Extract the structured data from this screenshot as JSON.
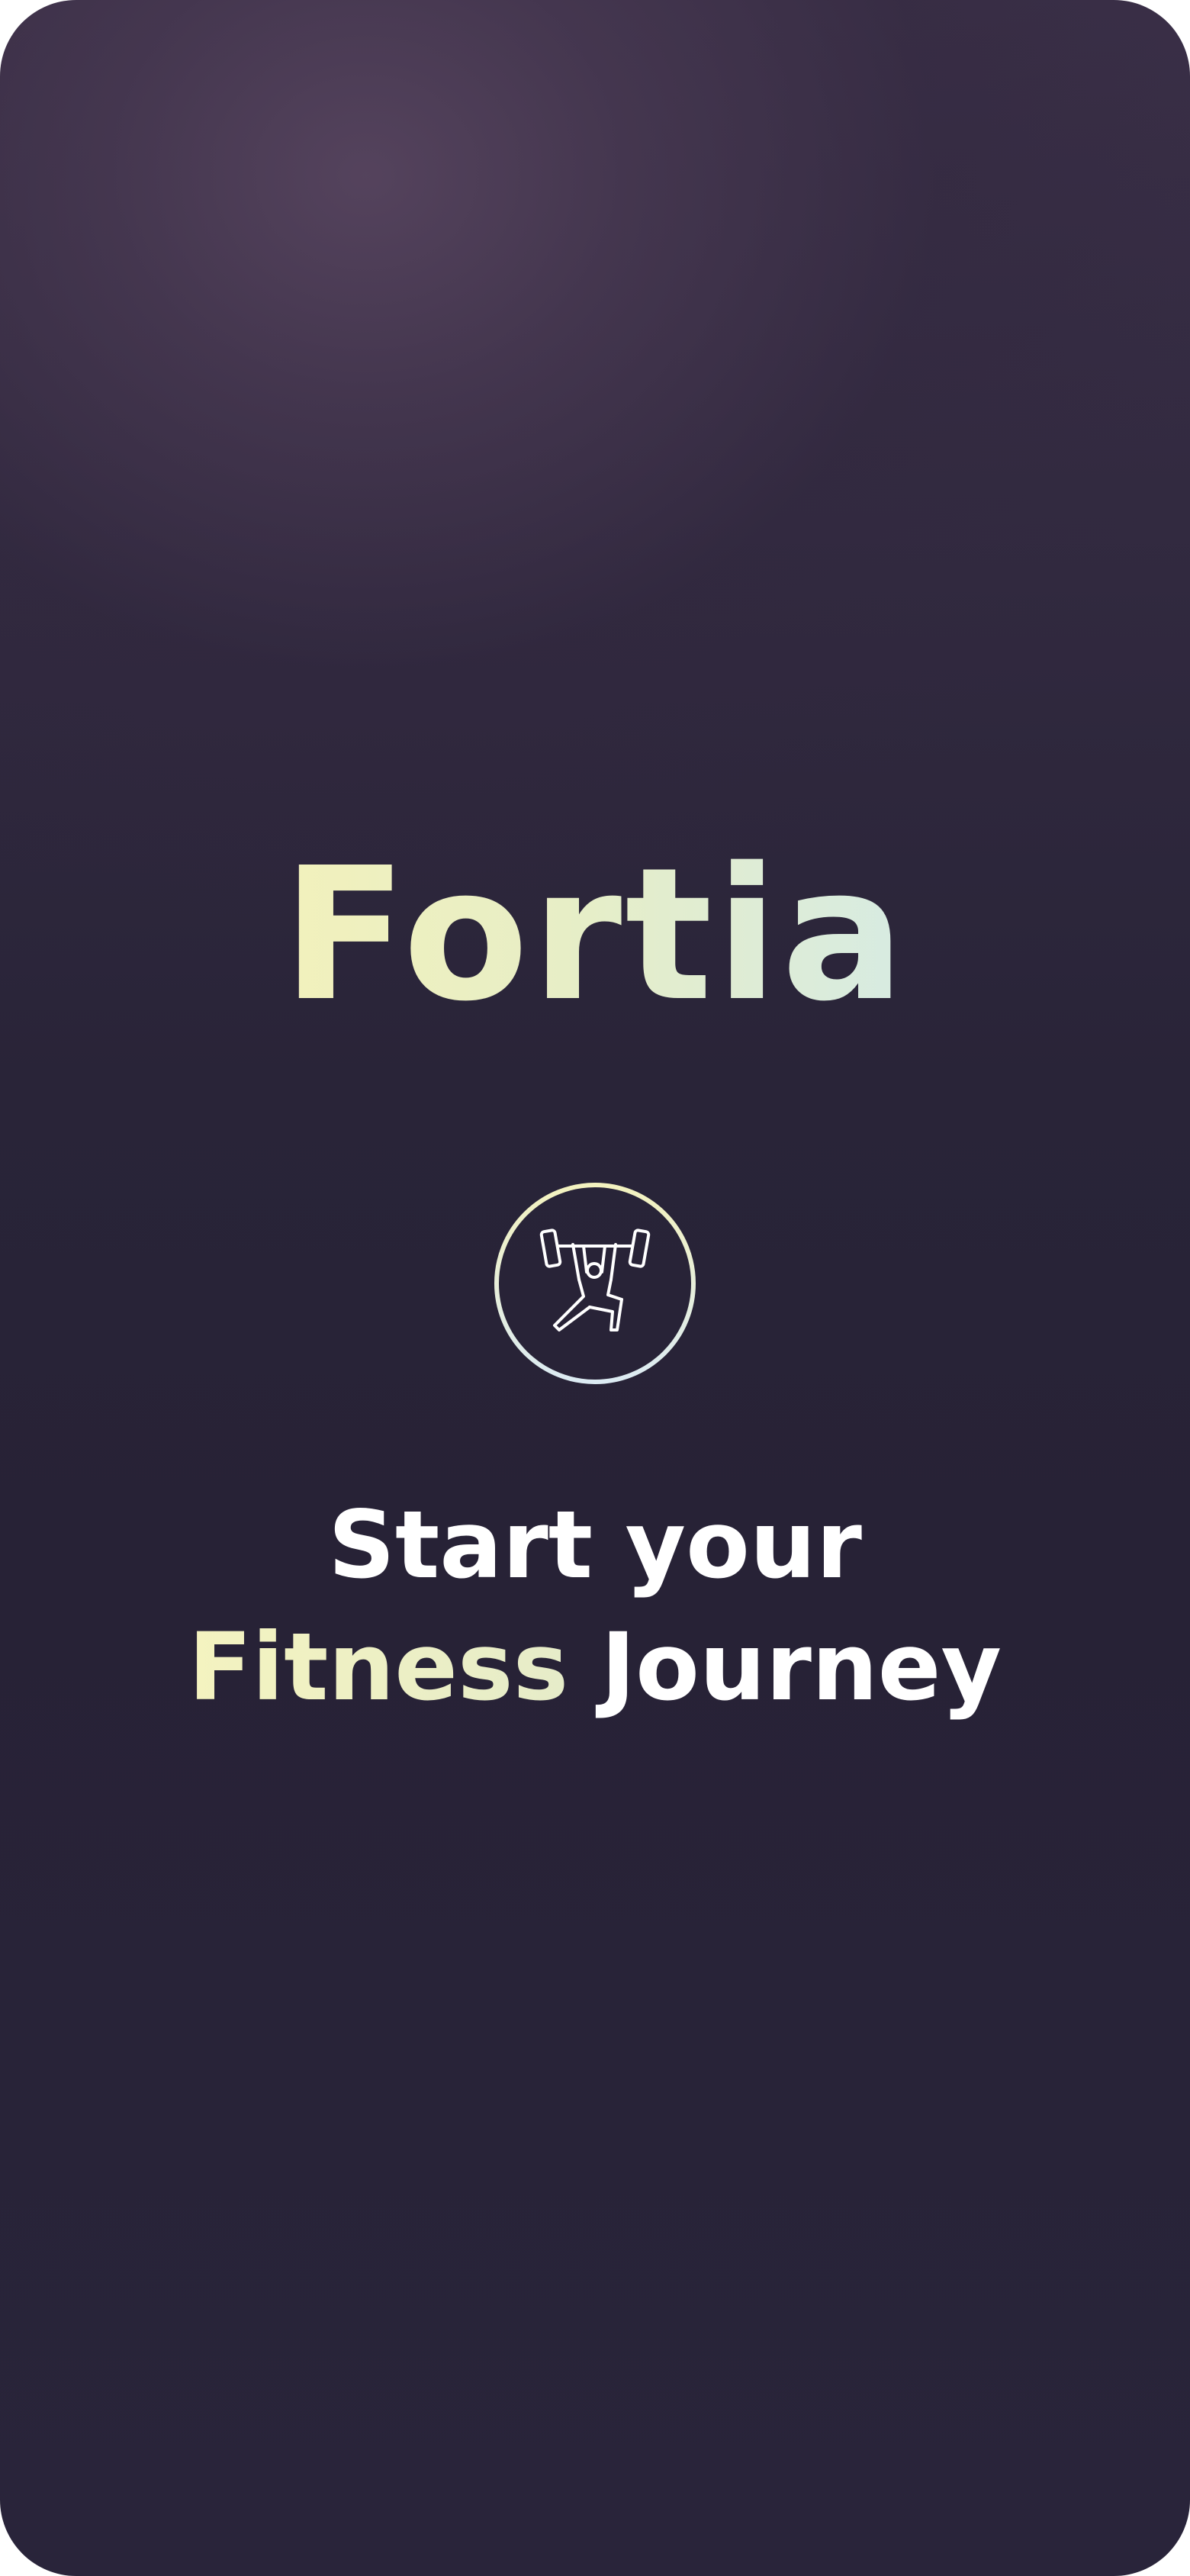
{
  "app": {
    "name": "Fortia"
  },
  "emblem": {
    "icon": "weightlifter-icon"
  },
  "headline": {
    "line1": "Start your",
    "line2_highlight": "Fitness",
    "line2_rest": "Journey"
  },
  "colors": {
    "background_top": "#4d3f58",
    "background_base": "#272236",
    "accent_start": "#f2f1bc",
    "accent_end": "#d7ebe2",
    "text": "#ffffff"
  }
}
